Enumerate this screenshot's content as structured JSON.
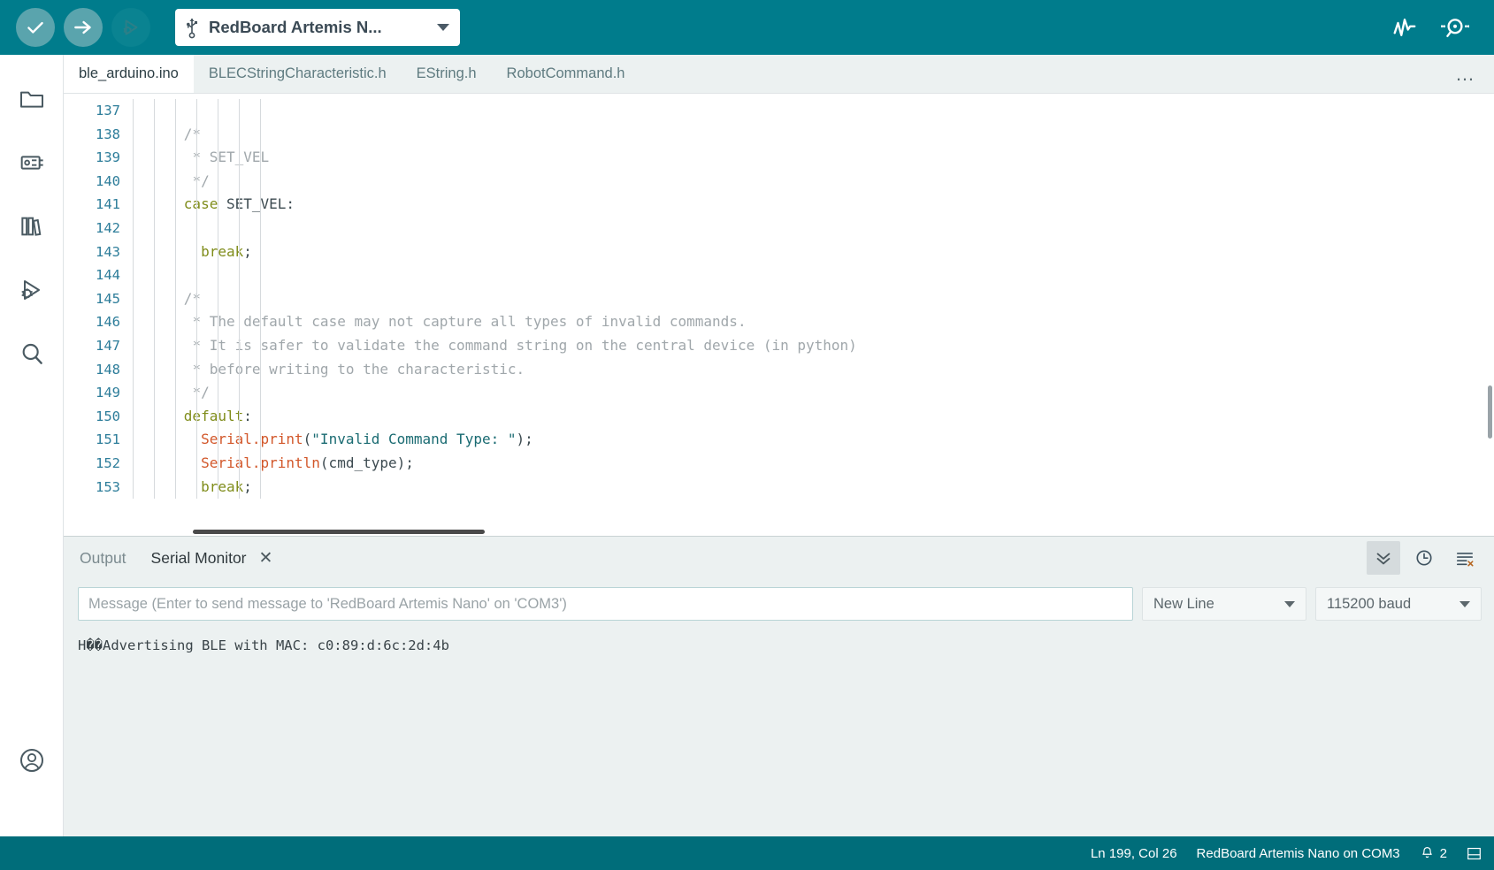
{
  "toolbar": {
    "verify_label": "Verify",
    "upload_label": "Upload",
    "debug_label": "Debug",
    "board_name": "RedBoard Artemis N...",
    "usb_icon": "usb-icon",
    "serial_plotter_icon": "serial-plotter-icon",
    "serial_monitor_icon": "serial-monitor-icon"
  },
  "activity_bar": {
    "items": [
      {
        "name": "sketchbook",
        "icon": "folder-icon"
      },
      {
        "name": "boards-manager",
        "icon": "board-chip-icon"
      },
      {
        "name": "library-manager",
        "icon": "books-icon"
      },
      {
        "name": "debug",
        "icon": "debug-icon"
      },
      {
        "name": "search",
        "icon": "search-icon"
      },
      {
        "name": "account",
        "icon": "account-icon"
      }
    ]
  },
  "tabs": {
    "items": [
      {
        "label": "ble_arduino.ino",
        "active": true
      },
      {
        "label": "BLECStringCharacteristic.h",
        "active": false
      },
      {
        "label": "EString.h",
        "active": false
      },
      {
        "label": "RobotCommand.h",
        "active": false
      }
    ],
    "more_label": "…"
  },
  "editor": {
    "first_line": 137,
    "lines": [
      {
        "n": 137,
        "tokens": []
      },
      {
        "n": 138,
        "tokens": [
          {
            "t": "      ",
            "c": "pl"
          },
          {
            "t": "/*",
            "c": "cmt"
          }
        ]
      },
      {
        "n": 139,
        "tokens": [
          {
            "t": "       ",
            "c": "pl"
          },
          {
            "t": "* SET_VEL",
            "c": "cmt"
          }
        ]
      },
      {
        "n": 140,
        "tokens": [
          {
            "t": "       ",
            "c": "pl"
          },
          {
            "t": "*/",
            "c": "cmt"
          }
        ]
      },
      {
        "n": 141,
        "tokens": [
          {
            "t": "      ",
            "c": "pl"
          },
          {
            "t": "case",
            "c": "key"
          },
          {
            "t": " SET_VEL:",
            "c": "pl"
          }
        ]
      },
      {
        "n": 142,
        "tokens": []
      },
      {
        "n": 143,
        "tokens": [
          {
            "t": "        ",
            "c": "pl"
          },
          {
            "t": "break",
            "c": "key"
          },
          {
            "t": ";",
            "c": "pl"
          }
        ]
      },
      {
        "n": 144,
        "tokens": []
      },
      {
        "n": 145,
        "tokens": [
          {
            "t": "      ",
            "c": "pl"
          },
          {
            "t": "/*",
            "c": "cmt"
          }
        ]
      },
      {
        "n": 146,
        "tokens": [
          {
            "t": "       ",
            "c": "pl"
          },
          {
            "t": "* The default case may not capture all types of invalid commands.",
            "c": "cmt"
          }
        ]
      },
      {
        "n": 147,
        "tokens": [
          {
            "t": "       ",
            "c": "pl"
          },
          {
            "t": "* It is safer to validate the command string on the central device (in python)",
            "c": "cmt"
          }
        ]
      },
      {
        "n": 148,
        "tokens": [
          {
            "t": "       ",
            "c": "pl"
          },
          {
            "t": "* before writing to the characteristic.",
            "c": "cmt"
          }
        ]
      },
      {
        "n": 149,
        "tokens": [
          {
            "t": "       ",
            "c": "pl"
          },
          {
            "t": "*/",
            "c": "cmt"
          }
        ]
      },
      {
        "n": 150,
        "tokens": [
          {
            "t": "      ",
            "c": "pl"
          },
          {
            "t": "default",
            "c": "key"
          },
          {
            "t": ":",
            "c": "pl"
          }
        ]
      },
      {
        "n": 151,
        "tokens": [
          {
            "t": "        ",
            "c": "pl"
          },
          {
            "t": "Serial.print",
            "c": "fn"
          },
          {
            "t": "(",
            "c": "pl"
          },
          {
            "t": "\"Invalid Command Type: \"",
            "c": "str"
          },
          {
            "t": ");",
            "c": "pl"
          }
        ]
      },
      {
        "n": 152,
        "tokens": [
          {
            "t": "        ",
            "c": "pl"
          },
          {
            "t": "Serial.println",
            "c": "fn"
          },
          {
            "t": "(cmd_type);",
            "c": "pl"
          }
        ]
      },
      {
        "n": 153,
        "tokens": [
          {
            "t": "        ",
            "c": "pl"
          },
          {
            "t": "break",
            "c": "key"
          },
          {
            "t": ";",
            "c": "pl"
          }
        ]
      }
    ],
    "colors": {
      "keyword": "#7f8c1a",
      "comment": "#a0a7ab",
      "function": "#d2572a",
      "string": "#1a6b72",
      "line_number": "#2d7d9a"
    }
  },
  "panel": {
    "tabs": [
      {
        "label": "Output",
        "active": false,
        "closable": false
      },
      {
        "label": "Serial Monitor",
        "active": true,
        "closable": true
      }
    ],
    "close_glyph": "✕",
    "actions": [
      {
        "name": "autoscroll",
        "icon": "double-chevron-down-icon",
        "active": true
      },
      {
        "name": "timestamp",
        "icon": "clock-icon",
        "active": false
      },
      {
        "name": "clear-output",
        "icon": "clear-lines-icon",
        "active": false
      }
    ],
    "message_placeholder": "Message (Enter to send message to 'RedBoard Artemis Nano' on 'COM3')",
    "message_value": "",
    "line_ending": "New Line",
    "baud_rate": "115200 baud",
    "console_lines": [
      "H��Advertising BLE with MAC: c0:89:d:6c:2d:4b"
    ]
  },
  "status_bar": {
    "cursor_position": "Ln 199, Col 26",
    "board_port": "RedBoard Artemis Nano on COM3",
    "notification_count": "2",
    "notification_icon": "bell-icon",
    "layout_icon": "panel-layout-icon"
  },
  "theme": {
    "accent": "#007c8c",
    "status_bar_bg": "#006d7a",
    "panel_bg": "#ecf1f1",
    "editor_bg": "#ffffff"
  }
}
